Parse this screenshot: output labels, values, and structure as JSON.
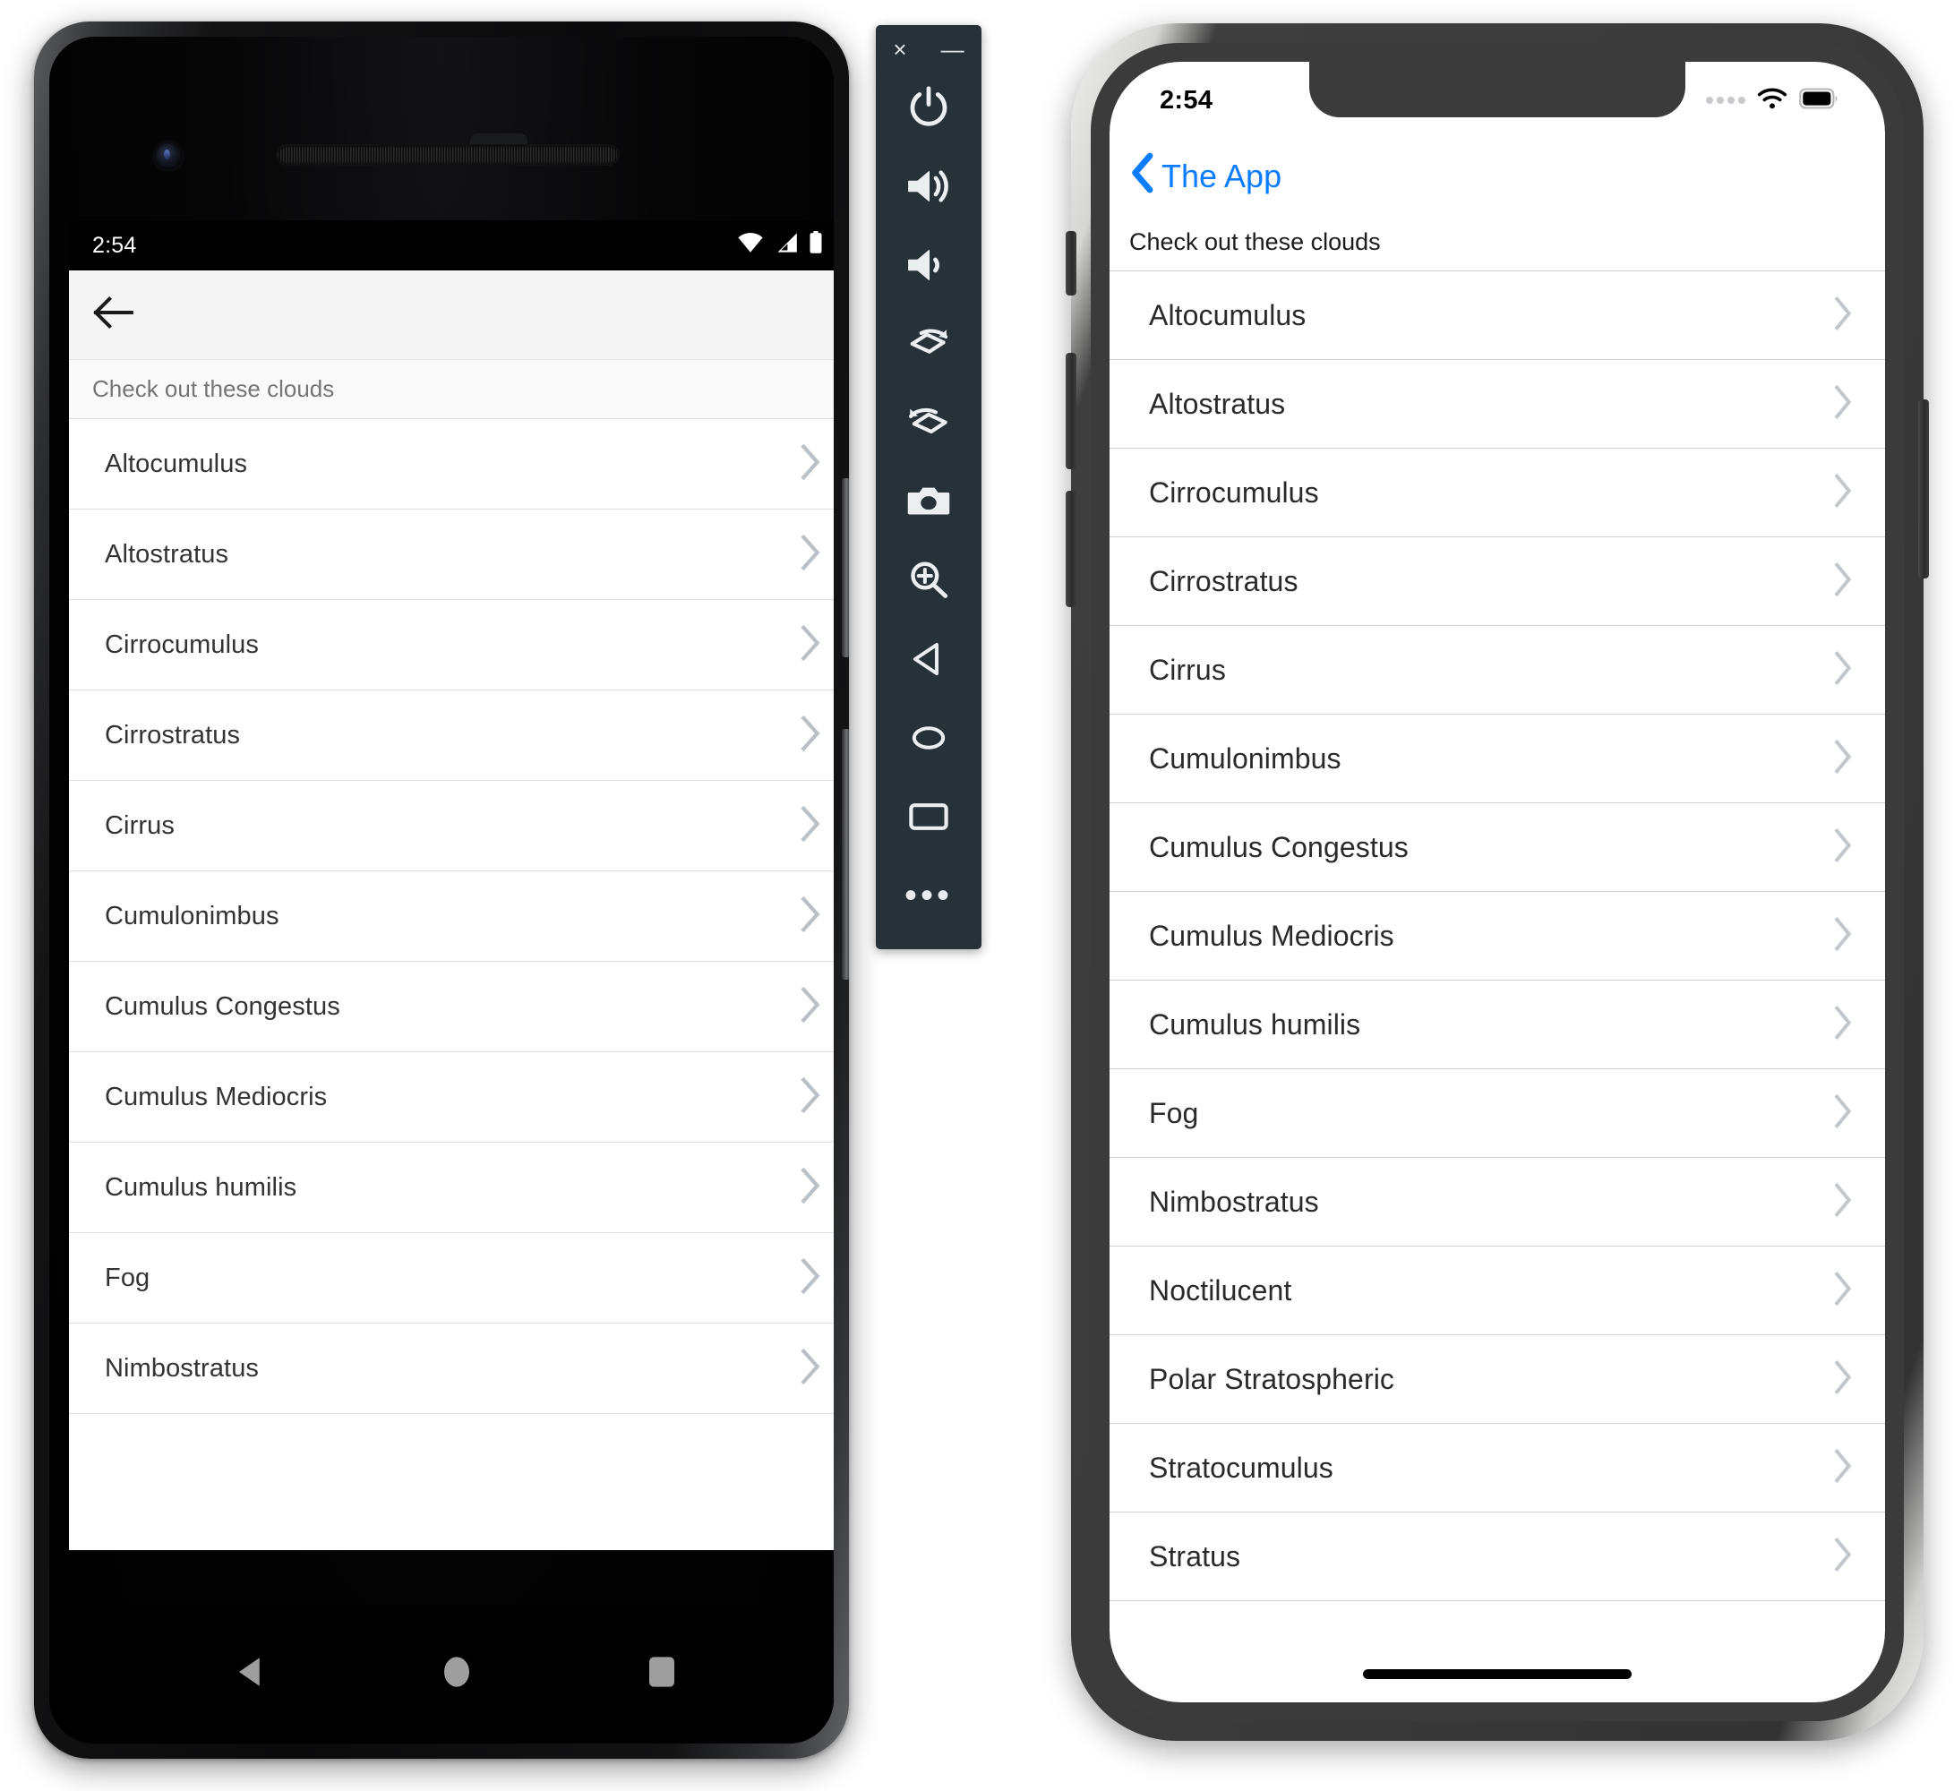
{
  "android": {
    "status": {
      "time": "2:54",
      "icons": [
        "wifi-icon",
        "cell-signal-icon",
        "battery-icon"
      ]
    },
    "appbar": {
      "back_icon": "arrow-left-icon"
    },
    "subheader": "Check out these clouds",
    "list_items": [
      "Altocumulus",
      "Altostratus",
      "Cirrocumulus",
      "Cirrostratus",
      "Cirrus",
      "Cumulonimbus",
      "Cumulus Congestus",
      "Cumulus Mediocris",
      "Cumulus humilis",
      "Fog",
      "Nimbostratus"
    ],
    "navbar": {
      "back": "triangle-back-icon",
      "home": "circle-home-icon",
      "recents": "square-recents-icon"
    }
  },
  "emulator_toolbar": {
    "window_buttons": [
      {
        "name": "close-button",
        "glyph": "×"
      },
      {
        "name": "minimize-button",
        "glyph": "—"
      }
    ],
    "buttons": [
      "power-icon",
      "volume-up-icon",
      "volume-down-icon",
      "rotate-left-icon",
      "rotate-right-icon",
      "screenshot-camera-icon",
      "zoom-in-icon",
      "back-icon",
      "home-icon",
      "overview-icon"
    ],
    "more_glyph": "•••",
    "background_color": "#263238"
  },
  "ios": {
    "status": {
      "time": "2:54",
      "icons": [
        "cellular-dots-icon",
        "wifi-icon",
        "battery-icon"
      ]
    },
    "navbar": {
      "back_label": "The App",
      "back_icon": "chevron-left-icon",
      "tint_color": "#0a7cff"
    },
    "subheader": "Check out these clouds",
    "list_items": [
      "Altocumulus",
      "Altostratus",
      "Cirrocumulus",
      "Cirrostratus",
      "Cirrus",
      "Cumulonimbus",
      "Cumulus Congestus",
      "Cumulus Mediocris",
      "Cumulus humilis",
      "Fog",
      "Nimbostratus",
      "Noctilucent",
      "Polar Stratospheric",
      "Stratocumulus",
      "Stratus"
    ]
  }
}
